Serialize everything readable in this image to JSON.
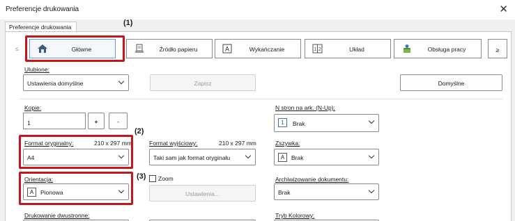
{
  "window": {
    "title": "Preferencje drukowania"
  },
  "tabs": [
    {
      "label": "Preferencje drukowania"
    }
  ],
  "nav": {
    "prev": "≤",
    "next": "≥",
    "items": [
      {
        "label": "Główne"
      },
      {
        "label": "Źródło papieru"
      },
      {
        "label": "Wykańczanie"
      },
      {
        "label": "Układ"
      },
      {
        "label": "Obsługa pracy"
      }
    ]
  },
  "favorites": {
    "label": "Ulubione:",
    "value": "Ustawienia domyślne",
    "save": "Zapisz",
    "defaults": "Domyślne"
  },
  "copies": {
    "label": "Kopie:",
    "value": "1",
    "plus": "+",
    "minus": "-"
  },
  "original_size": {
    "label": "Format oryginalny:",
    "dims": "210 x 297 mm",
    "value": "A4"
  },
  "output_size": {
    "label": "Format wyjściowy:",
    "dims": "210 x 297 mm",
    "value": "Taki sam jak format oryginału"
  },
  "orientation": {
    "label": "Orientacja:",
    "value": "Pionowa",
    "icon_letter": "A"
  },
  "zoom": {
    "label": "Zoom",
    "settings": "Ustawienia..."
  },
  "duplex": {
    "label": "Drukowanie dwustronne:"
  },
  "nup": {
    "label": "N stron na ark. (N-Up):",
    "value": "Brak",
    "icon_digit": "1"
  },
  "staple": {
    "label": "Zszywka:",
    "value": "Brak",
    "icon_letter": "A"
  },
  "archive": {
    "label": "Archiwizowanie dokumentu:",
    "value": "Brak"
  },
  "color_mode": {
    "label": "Tryb Kolorowy:"
  },
  "callouts": {
    "c1": "(1)",
    "c2": "(2)",
    "c3": "(3)"
  },
  "colors": {
    "highlight": "#c4161c"
  }
}
